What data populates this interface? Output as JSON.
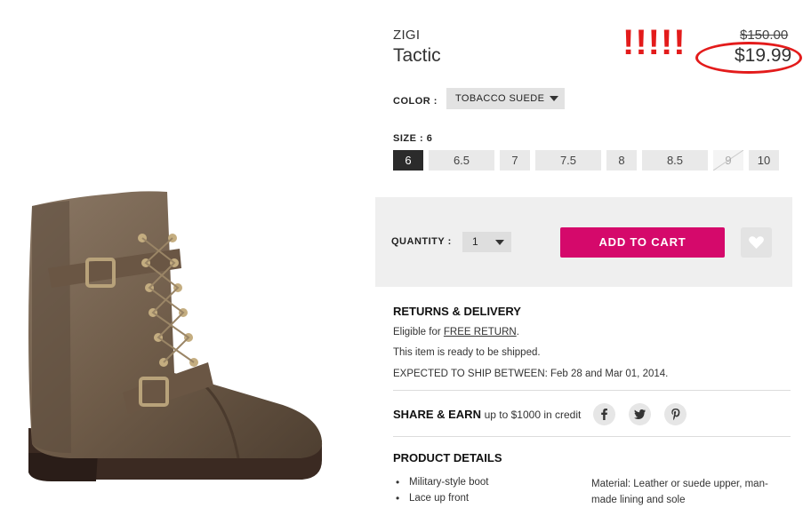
{
  "product": {
    "brand": "ZIGI",
    "name": "Tactic",
    "original_price": "$150.00",
    "sale_price": "$19.99",
    "annotation": "!!!!!"
  },
  "color": {
    "label": "COLOR :",
    "selected": "TOBACCO SUEDE"
  },
  "size": {
    "label": "SIZE : 6",
    "options": [
      "6",
      "6.5",
      "7",
      "7.5",
      "8",
      "8.5",
      "9",
      "10"
    ],
    "selected": "6",
    "unavailable": [
      "9"
    ]
  },
  "cart": {
    "quantity_label": "QUANTITY :",
    "quantity": "1",
    "add_to_cart": "ADD TO CART"
  },
  "returns": {
    "heading": "RETURNS & DELIVERY",
    "eligible_prefix": "Eligible for",
    "eligible_link": "FREE RETURN",
    "eligible_suffix": ".",
    "ready": "This item is ready to be shipped.",
    "ship_window": "EXPECTED TO SHIP BETWEEN: Feb 28 and Mar 01, 2014."
  },
  "share": {
    "heading": "SHARE & EARN",
    "sub": "up to $1000 in credit",
    "networks": [
      "facebook-icon",
      "twitter-icon",
      "pinterest-icon"
    ]
  },
  "details": {
    "heading": "PRODUCT DETAILS",
    "bullets": [
      "Military-style boot",
      "Lace up front"
    ],
    "material": "Material: Leather or suede upper, man-made lining and sole"
  },
  "colors": {
    "accent": "#d5096b",
    "annotation": "#e31b1b"
  }
}
